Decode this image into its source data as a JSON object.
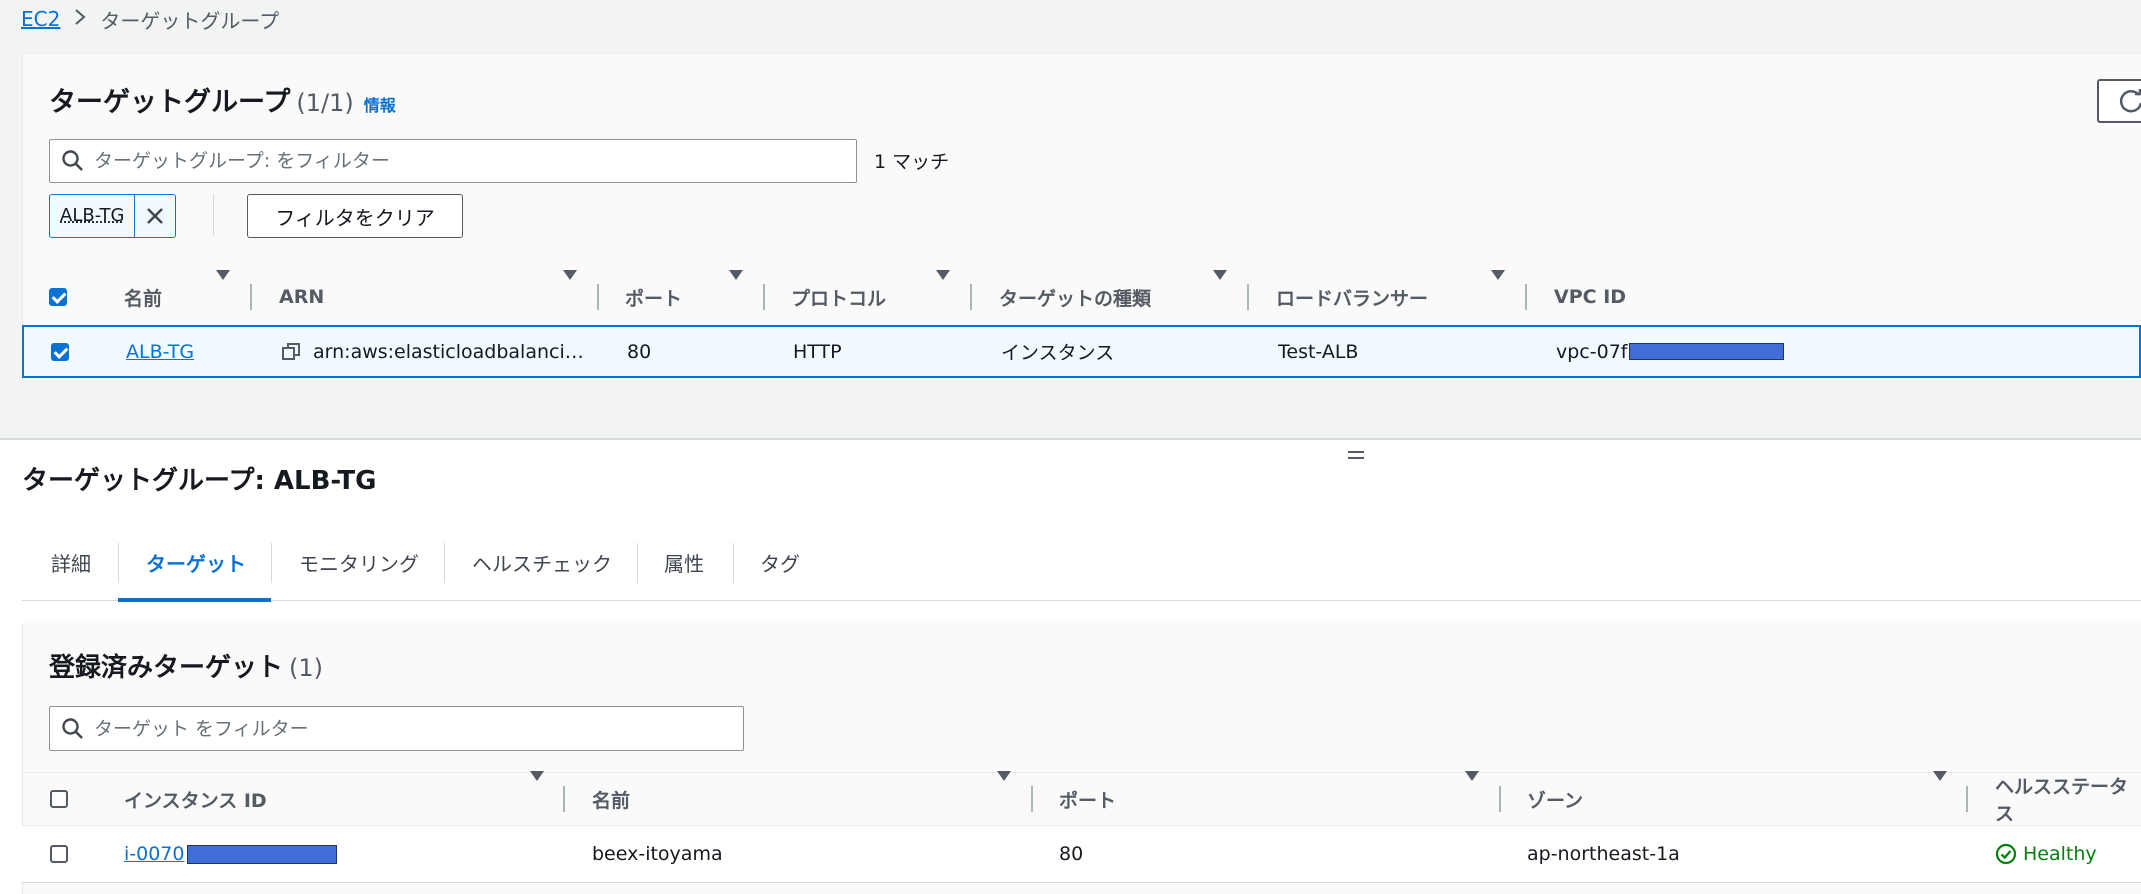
{
  "breadcrumb": {
    "root": "EC2",
    "current": "ターゲットグループ"
  },
  "tg_list": {
    "title": "ターゲットグループ",
    "count": "(1/1)",
    "info": "情報",
    "search_placeholder": "ターゲットグループ: をフィルター",
    "match_text": "1 マッチ",
    "filter_token": "ALB-TG",
    "clear_filter_label": "フィルタをクリア",
    "columns": [
      "名前",
      "ARN",
      "ポート",
      "プロトコル",
      "ターゲットの種類",
      "ロードバランサー",
      "VPC ID"
    ],
    "rows": [
      {
        "selected": true,
        "name": "ALB-TG",
        "arn": "arn:aws:elasticloadbalanci…",
        "port": "80",
        "protocol": "HTTP",
        "target_type": "インスタンス",
        "load_balancer": "Test-ALB",
        "vpc_id": "vpc-07f"
      }
    ]
  },
  "detail": {
    "title": "ターゲットグループ: ALB-TG",
    "tabs": [
      "詳細",
      "ターゲット",
      "モニタリング",
      "ヘルスチェック",
      "属性",
      "タグ"
    ],
    "active_tab": "ターゲット"
  },
  "registered": {
    "title": "登録済みターゲット",
    "count": "(1)",
    "search_placeholder": "ターゲット をフィルター",
    "columns": [
      "インスタンス ID",
      "名前",
      "ポート",
      "ゾーン",
      "ヘルスステータス"
    ],
    "rows": [
      {
        "selected": false,
        "instance_id": "i-0070",
        "name": "beex-itoyama",
        "port": "80",
        "zone": "ap-northeast-1a",
        "health": "Healthy"
      }
    ]
  },
  "colors": {
    "link": "#0972d3",
    "healthy": "#037f0c",
    "redaction": "#3f6fd6"
  }
}
